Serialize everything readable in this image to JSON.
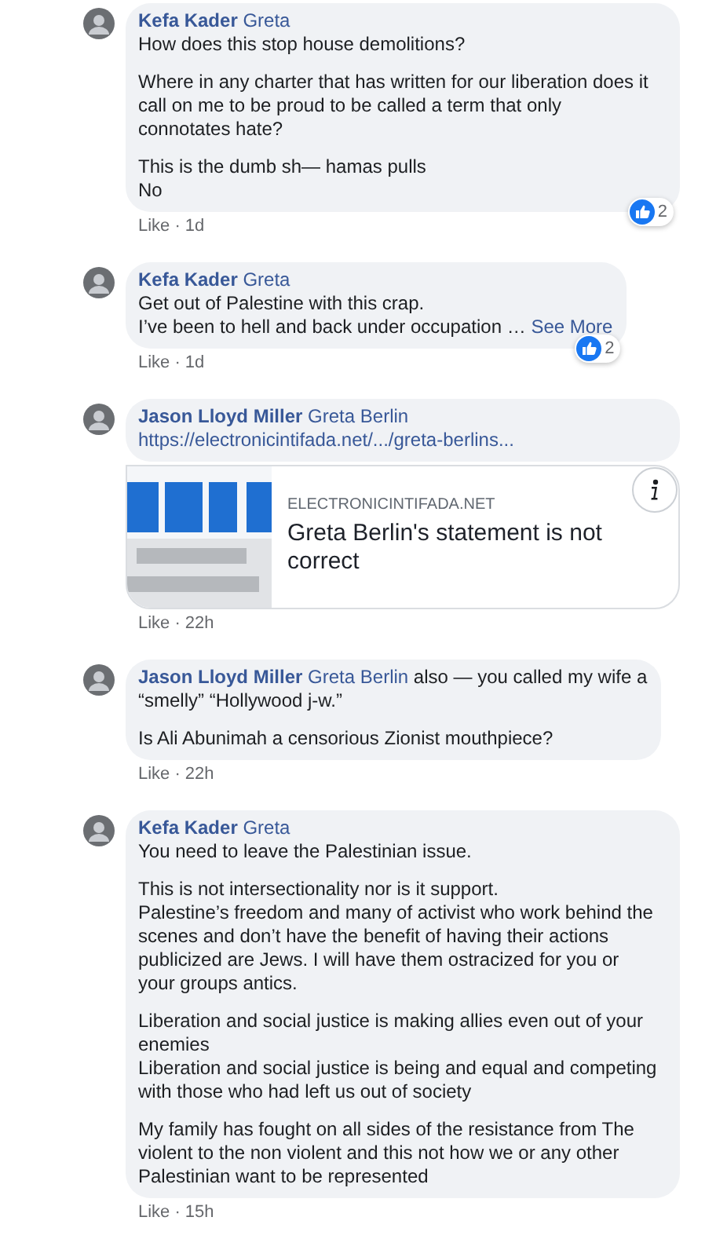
{
  "comments": [
    {
      "author": "Kefa Kader",
      "mention": "Greta",
      "paragraphs": [
        "How does this stop house demolitions?",
        "Where in any charter that has written for our liberation does it\ncall on me to be proud to be called a term that only\nconnotates hate?",
        "This is the dumb sh— hamas pulls\nNo"
      ],
      "reactions": {
        "count": "2"
      },
      "like": "Like",
      "separator": "·",
      "time": "1d"
    },
    {
      "author": "Kefa Kader",
      "mention": "Greta",
      "paragraphs": [
        "Get out of Palestine with this crap.\nI’ve been to hell and back under occupation …"
      ],
      "see_more": "See More",
      "reactions": {
        "count": "2"
      },
      "like": "Like",
      "separator": "·",
      "time": "1d"
    },
    {
      "author": "Jason Lloyd Miller",
      "mention": "Greta Berlin",
      "link_url": "https://electronicintifada.net/.../greta-berlins...",
      "link_preview": {
        "domain": "ELECTRONICINTIFADA.NET",
        "title": "Greta Berlin's statement is not\ncorrect"
      },
      "like": "Like",
      "separator": "·",
      "time": "22h"
    },
    {
      "author": "Jason Lloyd Miller",
      "mention": "Greta Berlin",
      "inline_text": "also — you called my wife a",
      "paragraphs": [
        "“smelly” “Hollywood j-w.”",
        "Is Ali Abunimah a censorious Zionist mouthpiece?"
      ],
      "like": "Like",
      "separator": "·",
      "time": "22h"
    },
    {
      "author": "Kefa Kader",
      "mention": "Greta",
      "paragraphs": [
        "You need to leave the Palestinian issue.",
        "This is not intersectionality nor is it support.\nPalestine’s freedom and many of activist who work behind the\nscenes and don’t have the benefit of having their actions\npublicized are Jews. I will have them ostracized for you or\nyour groups antics.",
        "Liberation and social justice is making allies even out of your\nenemies\nLiberation and social justice is being and equal and competing\nwith those who had left us out of society",
        "My family has fought on all sides of the resistance from The\nviolent to the non violent and this not how we or any other\nPalestinian want to be represented"
      ],
      "like": "Like",
      "separator": "·",
      "time": "15h"
    }
  ]
}
